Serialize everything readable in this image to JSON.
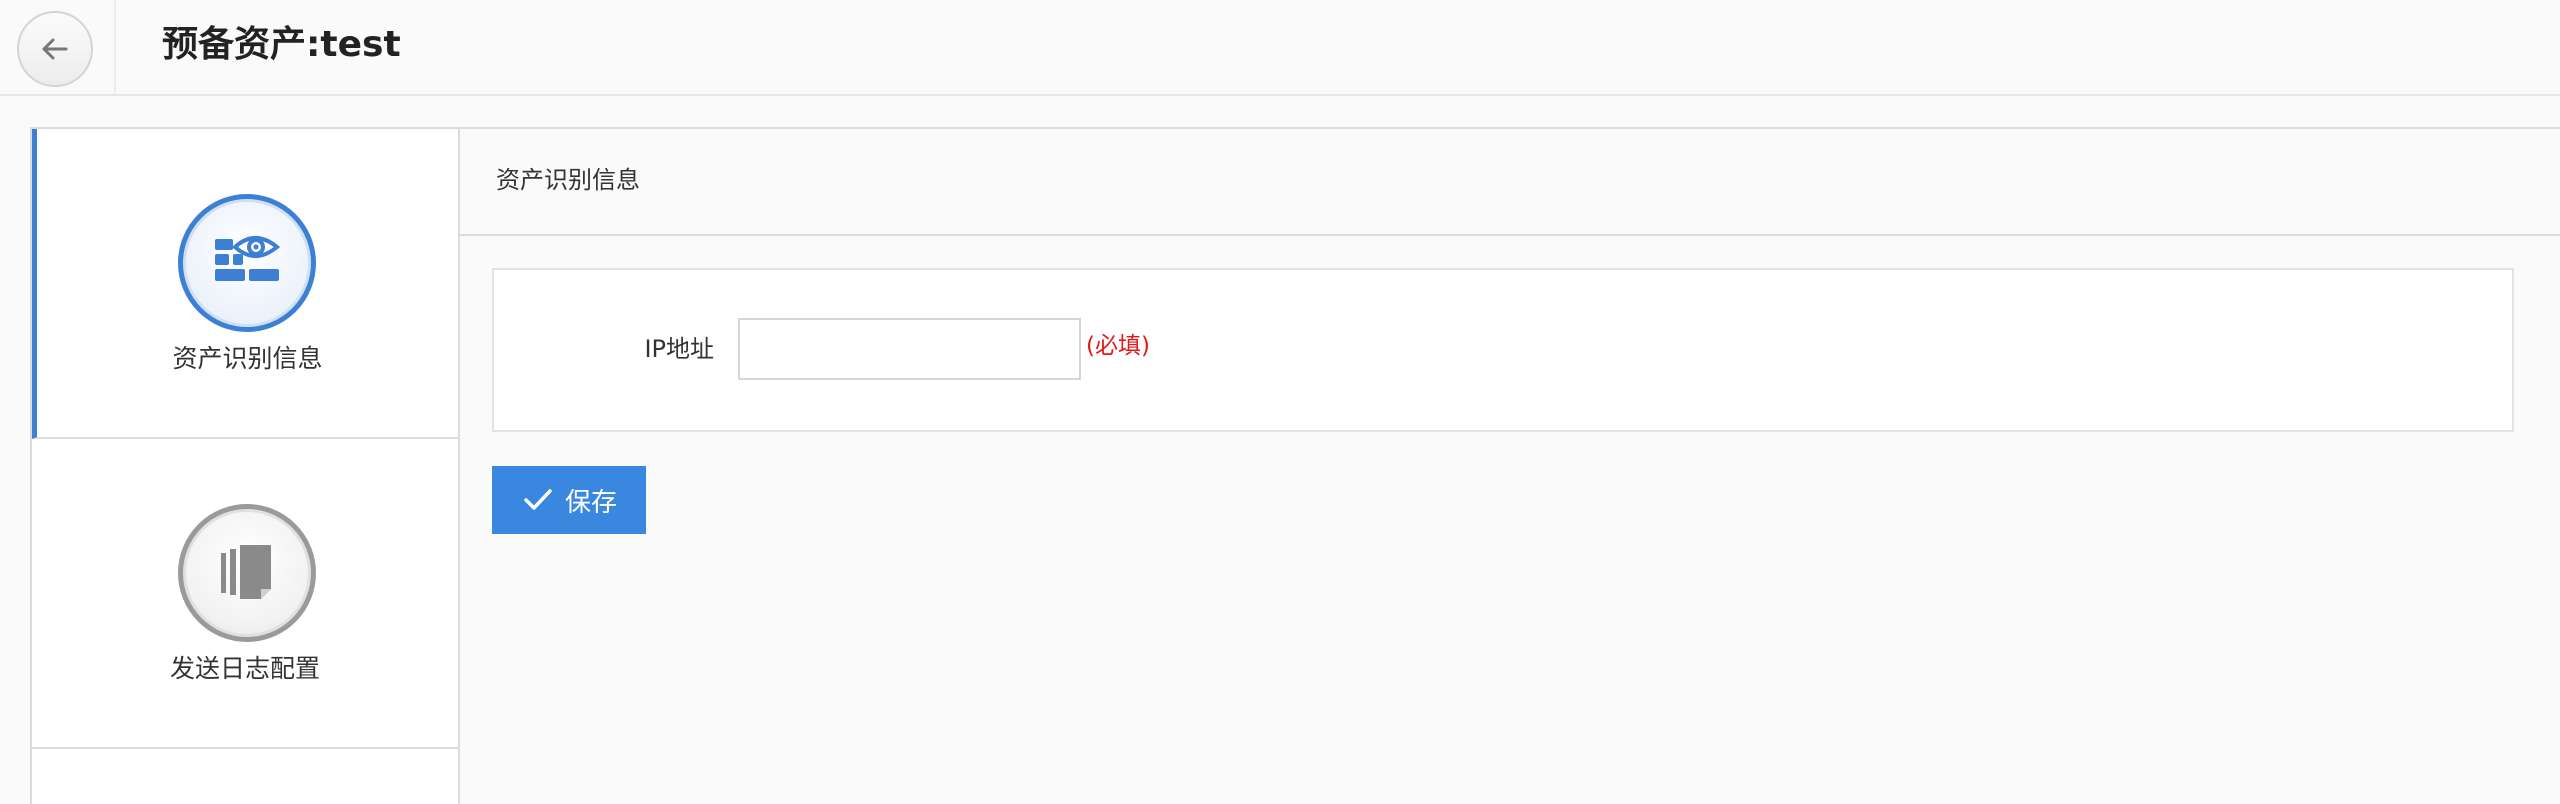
{
  "header": {
    "title": "预备资产:test"
  },
  "sidebar": {
    "items": [
      {
        "label": "资产识别信息",
        "icon": "asset-identify-icon",
        "active": true,
        "color": "#3d7fd3"
      },
      {
        "label": "发送日志配置",
        "icon": "log-config-icon",
        "active": false,
        "color": "#8a8a8a"
      }
    ]
  },
  "content": {
    "title": "资产识别信息",
    "form": {
      "ip_label": "IP地址",
      "ip_value": "",
      "required_text": "(必填)"
    },
    "save_label": "保存"
  },
  "colors": {
    "accent": "#3a87e0",
    "required": "#e0191c"
  }
}
